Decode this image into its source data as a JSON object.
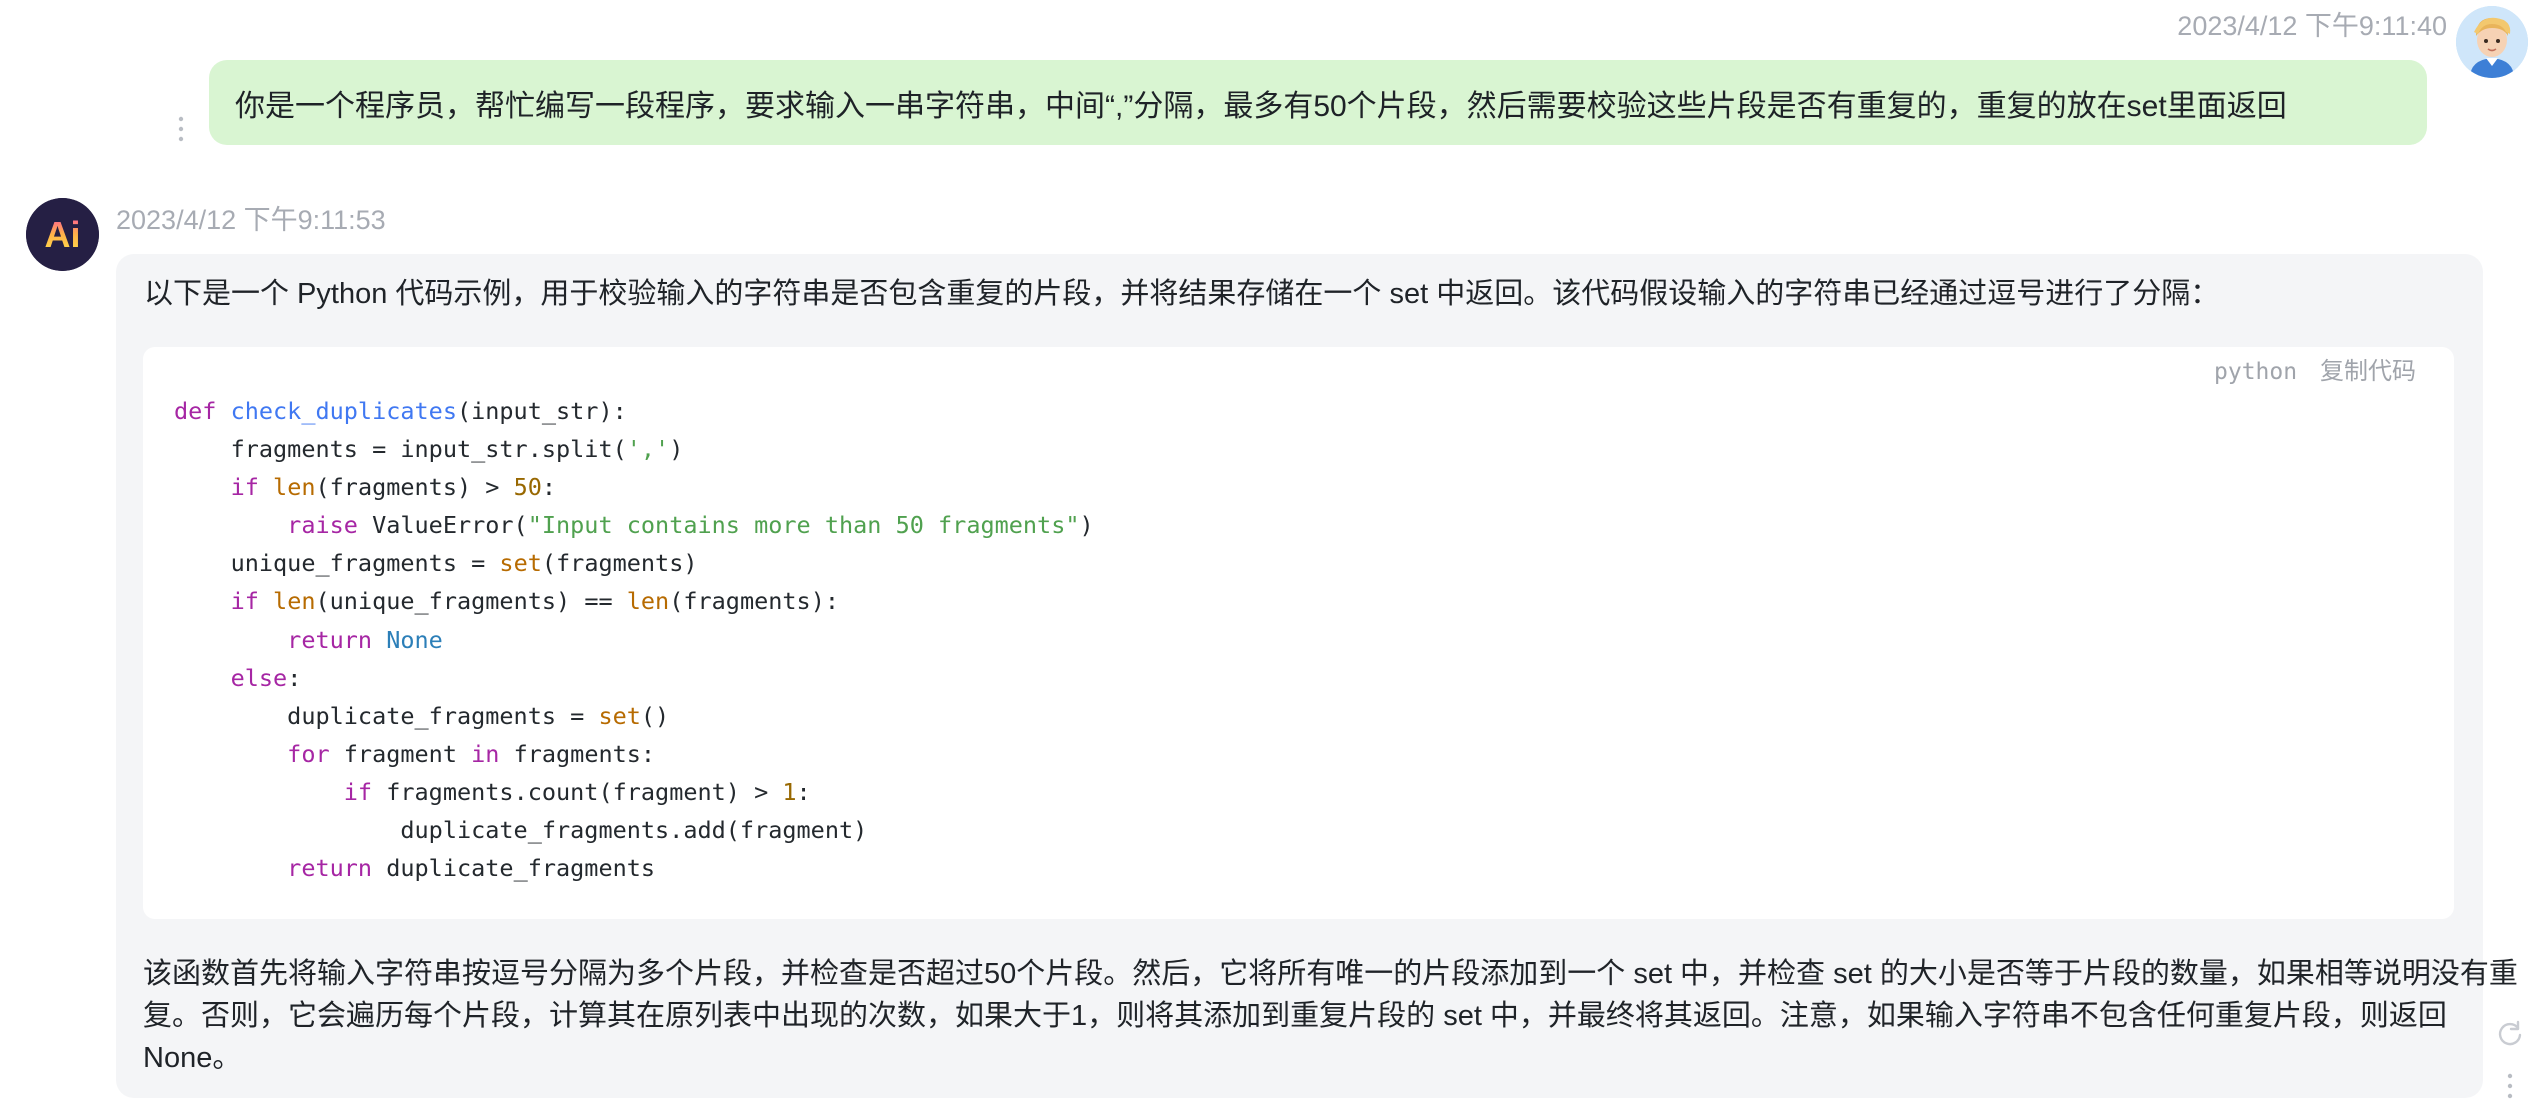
{
  "user_message": {
    "timestamp": "2023/4/12 下午9:11:40",
    "text": "你是一个程序员，帮忙编写一段程序，要求输入一串字符串，中间“,”分隔，最多有50个片段，然后需要校验这些片段是否有重复的，重复的放在set里面返回",
    "avatar_icon": "cartoon-boy-avatar-icon",
    "bubble_color": "#d9f5d2"
  },
  "ai_message": {
    "avatar_text": "Ai",
    "timestamp": "2023/4/12 下午9:11:53",
    "intro": "以下是一个 Python 代码示例，用于校验输入的字符串是否包含重复的片段，并将结果存储在一个 set 中返回。该代码假设输入的字符串已经通过逗号进行了分隔：",
    "code_block": {
      "language": "python",
      "copy_label": "复制代码",
      "lines": [
        [
          [
            "kw",
            "def "
          ],
          [
            "fn",
            "check_duplicates"
          ],
          [
            "",
            "(input_str):"
          ]
        ],
        [
          [
            "",
            "    fragments = input_str.split("
          ],
          [
            "str",
            "','"
          ],
          [
            "",
            ")"
          ]
        ],
        [
          [
            "kw",
            "    if "
          ],
          [
            "bi",
            "len"
          ],
          [
            "",
            "(fragments) > "
          ],
          [
            "num",
            "50"
          ],
          [
            "",
            ":"
          ]
        ],
        [
          [
            "kw",
            "        raise "
          ],
          [
            "",
            "ValueError("
          ],
          [
            "str",
            "\"Input contains more than 50 fragments\""
          ],
          [
            "",
            ")"
          ]
        ],
        [
          [
            "",
            "    unique_fragments = "
          ],
          [
            "bi",
            "set"
          ],
          [
            "",
            "(fragments)"
          ]
        ],
        [
          [
            "kw",
            "    if "
          ],
          [
            "bi",
            "len"
          ],
          [
            "",
            "(unique_fragments) == "
          ],
          [
            "bi",
            "len"
          ],
          [
            "",
            "(fragments):"
          ]
        ],
        [
          [
            "kw",
            "        return "
          ],
          [
            "cn",
            "None"
          ]
        ],
        [
          [
            "kw",
            "    else"
          ],
          [
            "",
            ":"
          ]
        ],
        [
          [
            "",
            "        duplicate_fragments = "
          ],
          [
            "bi",
            "set"
          ],
          [
            "",
            "()"
          ]
        ],
        [
          [
            "kw",
            "        for "
          ],
          [
            "",
            "fragment "
          ],
          [
            "kw",
            "in "
          ],
          [
            "",
            "fragments:"
          ]
        ],
        [
          [
            "kw",
            "            if "
          ],
          [
            "",
            "fragments.count(fragment) > "
          ],
          [
            "num",
            "1"
          ],
          [
            "",
            ":"
          ]
        ],
        [
          [
            "",
            "                duplicate_fragments.add(fragment)"
          ]
        ],
        [
          [
            "kw",
            "        return "
          ],
          [
            "",
            "duplicate_fragments"
          ]
        ]
      ]
    },
    "summary_lines": [
      "该函数首先将输入字符串按逗号分隔为多个片段，并检查是否超过50个片段。然后，它将所有唯一的片段添加到一个 set 中，并检查 set 的大小是否等于片段的数量，如果相等说明没有重",
      "复。否则，它会遍历每个片段，计算其在原列表中出现的次数，如果大于1，则将其添加到重复片段的 set 中，并最终将其返回。注意，如果输入字符串不包含任何重复片段，则返回",
      "None。"
    ]
  },
  "icons": {
    "user_more": "vertical-dots-icon",
    "ai_more": "vertical-dots-icon",
    "regenerate": "refresh-icon"
  }
}
